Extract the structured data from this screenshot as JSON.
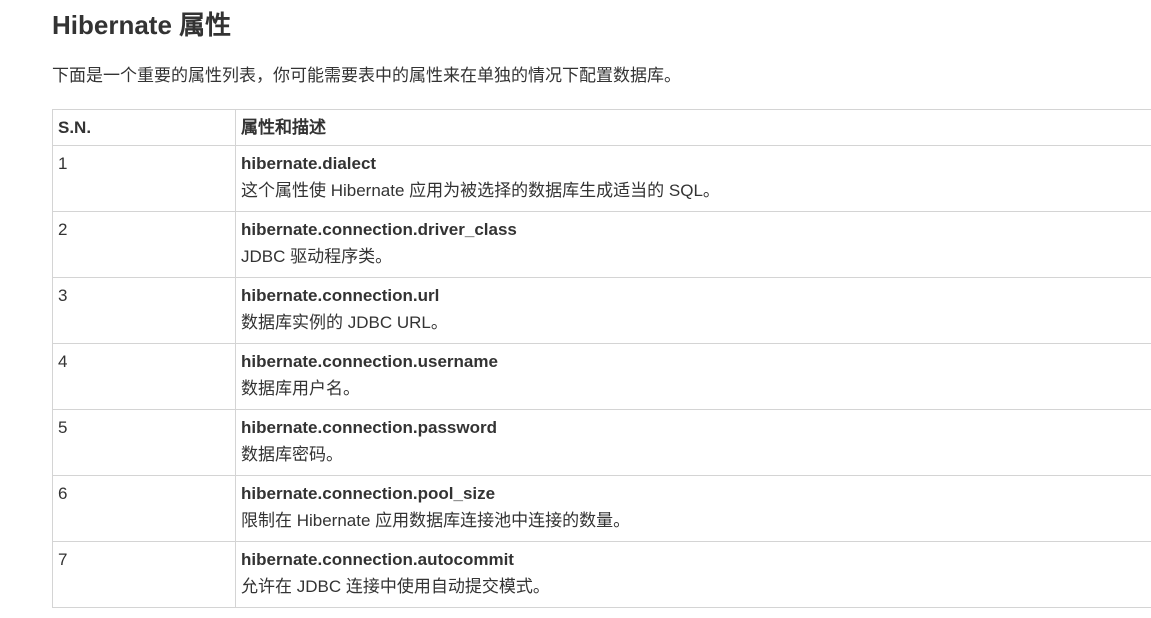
{
  "page": {
    "title": "Hibernate 属性",
    "intro": "下面是一个重要的属性列表，你可能需要表中的属性来在单独的情况下配置数据库。"
  },
  "table": {
    "headers": [
      "S.N.",
      "属性和描述"
    ],
    "rows": [
      {
        "sn": "1",
        "name": "hibernate.dialect",
        "desc": "这个属性使 Hibernate 应用为被选择的数据库生成适当的 SQL。"
      },
      {
        "sn": "2",
        "name": "hibernate.connection.driver_class",
        "desc": "JDBC 驱动程序类。"
      },
      {
        "sn": "3",
        "name": "hibernate.connection.url",
        "desc": "数据库实例的 JDBC URL。"
      },
      {
        "sn": "4",
        "name": "hibernate.connection.username",
        "desc": "数据库用户名。"
      },
      {
        "sn": "5",
        "name": "hibernate.connection.password",
        "desc": "数据库密码。"
      },
      {
        "sn": "6",
        "name": "hibernate.connection.pool_size",
        "desc": "限制在 Hibernate 应用数据库连接池中连接的数量。"
      },
      {
        "sn": "7",
        "name": "hibernate.connection.autocommit",
        "desc": "允许在 JDBC 连接中使用自动提交模式。"
      }
    ]
  }
}
